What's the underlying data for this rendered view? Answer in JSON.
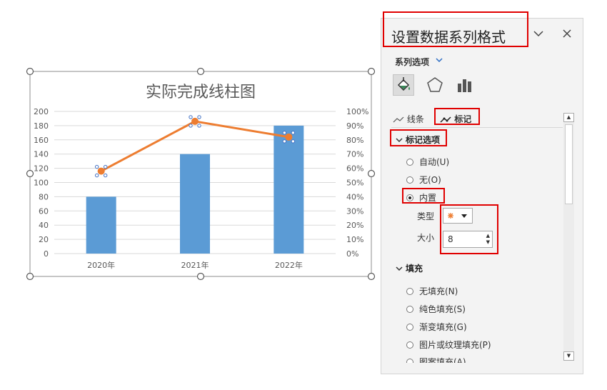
{
  "chart": {
    "chart_data": {
      "type": "bar",
      "title": "实际完成线柱图",
      "categories": [
        "2020年",
        "2021年",
        "2022年"
      ],
      "series": [
        {
          "values": [
            80,
            140,
            180
          ],
          "color": "#5b9bd5",
          "kind": "bar",
          "axis": "left"
        },
        {
          "values": [
            0.58,
            0.93,
            0.82
          ],
          "color": "#ed7d31",
          "kind": "line",
          "axis": "right",
          "marker": "circle"
        }
      ],
      "y_left": {
        "ticks": [
          "0",
          "20",
          "40",
          "60",
          "80",
          "100",
          "120",
          "140",
          "160",
          "180",
          "200"
        ],
        "ylim": [
          0,
          200
        ]
      },
      "y_right": {
        "ticks": [
          "0%",
          "10%",
          "20%",
          "30%",
          "40%",
          "50%",
          "60%",
          "70%",
          "80%",
          "90%",
          "100%"
        ],
        "ylim": [
          0,
          1
        ]
      },
      "grid": true,
      "gridline_color": "#d9d9d9"
    }
  },
  "pane": {
    "title": "设置数据系列格式",
    "collapse_icon": "chevron-down-icon",
    "close_icon": "close-icon",
    "series_options_label": "系列选项",
    "category_icons": [
      "paint-bucket-icon",
      "pentagon-icon",
      "bar-chart-icon"
    ],
    "tabs": {
      "line": "线条",
      "marker": "标记"
    },
    "marker_section": "标记选项",
    "marker_options": [
      {
        "label": "自动(U)",
        "selected": false
      },
      {
        "label": "无(O)",
        "selected": false
      },
      {
        "label": "内置",
        "selected": true
      }
    ],
    "type_label": "类型",
    "type_marker_color": "#ed7d31",
    "size_label": "大小",
    "size_value": "8",
    "fill_section": "填充",
    "fill_options": [
      {
        "label": "无填充(N)"
      },
      {
        "label": "纯色填充(S)"
      },
      {
        "label": "渐变填充(G)"
      },
      {
        "label": "图片或纹理填充(P)"
      },
      {
        "label": "图案填充(A)"
      }
    ],
    "highlight_color": "#e00000"
  }
}
